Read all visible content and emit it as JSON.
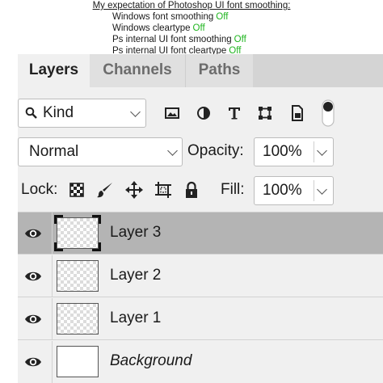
{
  "note": {
    "title": "My expectation of Photoshop UI font smoothing:",
    "rows": [
      {
        "label": "Windows font smoothing",
        "value": "Off"
      },
      {
        "label": "Windows cleartype",
        "value": "Off"
      },
      {
        "label": "Ps internal UI font smoothing",
        "value": "Off"
      },
      {
        "label": "Ps internal UI font cleartype",
        "value": "Off"
      }
    ],
    "value_color": "#1fb51f"
  },
  "tabs": [
    {
      "label": "Layers",
      "active": true
    },
    {
      "label": "Channels",
      "active": false
    },
    {
      "label": "Paths",
      "active": false
    }
  ],
  "filter": {
    "kind_label": "Kind",
    "icons": [
      "image-filter-icon",
      "adjustment-filter-icon",
      "type-filter-icon",
      "shape-filter-icon",
      "smart-object-filter-icon",
      "filter-toggle-icon"
    ]
  },
  "blend": {
    "mode": "Normal",
    "opacity_label": "Opacity:",
    "opacity_value": "100%"
  },
  "lock": {
    "label": "Lock:",
    "icons": [
      "lock-transparent-pixels-icon",
      "lock-image-pixels-icon",
      "lock-position-icon",
      "lock-artboard-icon",
      "lock-all-icon"
    ],
    "fill_label": "Fill:",
    "fill_value": "100%"
  },
  "layers": [
    {
      "name": "Layer 3",
      "selected": true,
      "thumb": "transparent",
      "visible": true
    },
    {
      "name": "Layer 2",
      "selected": false,
      "thumb": "transparent",
      "visible": true
    },
    {
      "name": "Layer 1",
      "selected": false,
      "thumb": "transparent",
      "visible": true
    },
    {
      "name": "Background",
      "selected": false,
      "thumb": "white",
      "visible": true,
      "italic": true
    }
  ],
  "colors": {
    "panel_bg": "#f0f0f0",
    "tabbar_bg": "#d4d4d4",
    "selected_layer_bg": "#b4b4b4"
  }
}
